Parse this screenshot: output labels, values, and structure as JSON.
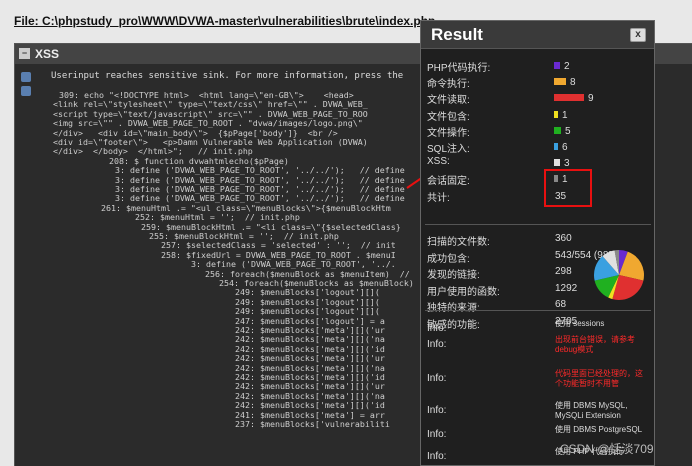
{
  "file_path": "File: C:\\phpstudy_pro\\WWW\\DVWA-master\\vulnerabilities\\brute\\index.php",
  "panel": {
    "title": "XSS",
    "message": "Userinput reaches sensitive sink. For more information, press the"
  },
  "code_lines": [
    "309: echo \"<!DOCTYPE html>  <html lang=\\\"en-GB\\\">    <head>",
    "<link rel=\\\"stylesheet\\\" type=\\\"text/css\\\" href=\\\"\" . DVWA_WEB_",
    "<script type=\\\"text/javascript\\\" src=\\\"\" . DVWA_WEB_PAGE_TO_ROO",
    "<img src=\\\"\" . DVWA_WEB_PAGE_TO_ROOT . \"dvwa/images/logo.png\\\"",
    "</div>   <div id=\\\"main_body\\\">  {$pPage['body']}  <br />",
    "<div id=\\\"footer\\\">   <p>Damn Vulnerable Web Application (DVWA)",
    "</div>  </body>  </html>\";   // init.php",
    "208: $ function dvwahtmlecho($pPage)",
    "3: define ('DVWA_WEB_PAGE_TO_ROOT', '../../');   // define",
    "3: define ('DVWA_WEB_PAGE_TO_ROOT', '../../');   // define",
    "3: define ('DVWA_WEB_PAGE_TO_ROOT', '../../');   // define",
    "3: define ('DVWA_WEB_PAGE_TO_ROOT', '../../');   // define",
    "261: $menuHtml .= \"<ul class=\\\"menuBlocks\\\">{$menuBlockHtm",
    "252: $menuHtml = '';  // init.php",
    "259: $menuBlockHtml .= \"<li class=\\\"{$selectedClass}",
    "255: $menuBlockHtml = '';  // init.php",
    "257: $selectedClass = 'selected' : '';  // init",
    "258: $fixedUrl = DVWA_WEB_PAGE_TO_ROOT . $menuI",
    "3: define ('DVWA_WEB_PAGE_TO_ROOT', '../.",
    "256: foreach($menuBlock as $menuItem)  //",
    "254: foreach($menuBlocks as $menuBlock)",
    "249: $menuBlocks['logout'][]( ",
    "249: $menuBlocks['logout'][]( ",
    "249: $menuBlocks['logout'][]( ",
    "247: $menuBlocks['logout'] = a",
    "242: $menuBlocks['meta'][]('ur",
    "242: $menuBlocks['meta'][]('na",
    "242: $menuBlocks['meta'][]('id",
    "242: $menuBlocks['meta'][]('ur",
    "242: $menuBlocks['meta'][]('na",
    "242: $menuBlocks['meta'][]('id",
    "242: $menuBlocks['meta'][]('ur",
    "242: $menuBlocks['meta'][]('na",
    "242: $menuBlocks['meta'][]('id",
    "241: $menuBlocks['meta'] = arr",
    "237: $menuBlocks['vulnerabiliti"
  ],
  "result": {
    "title": "Result",
    "close_label": "x",
    "vulns": [
      {
        "label": "PHP代码执行:",
        "value": "2",
        "color": "#6a2ad0"
      },
      {
        "label": "命令执行:",
        "value": "8",
        "color": "#f0a830"
      },
      {
        "label": "文件读取:",
        "value": "9",
        "color": "#e03030"
      },
      {
        "label": "文件包含:",
        "value": "1",
        "color": "#f0e020"
      },
      {
        "label": "文件操作:",
        "value": "5",
        "color": "#20b020"
      },
      {
        "label": "SQL注入:",
        "value": "6",
        "color": "#3aa0e0"
      },
      {
        "label": "XSS:",
        "value": "3",
        "color": "#e0e0e0"
      },
      {
        "label": "会话固定:",
        "value": "1",
        "color": "#888888"
      },
      {
        "label": "共计:",
        "value": "35",
        "color": ""
      }
    ],
    "stats": [
      {
        "label": "扫描的文件数:",
        "value": "360"
      },
      {
        "label": "成功包含:",
        "value": "543/554 (98%)"
      },
      {
        "label": "发现的链接:",
        "value": "298"
      },
      {
        "label": "用户使用的函数:",
        "value": "1292"
      },
      {
        "label": "独特的来源:",
        "value": "68"
      },
      {
        "label": "敏感的功能:",
        "value": "2705"
      }
    ],
    "info": [
      {
        "label": "Info:",
        "text": "使用 sessions",
        "red": false
      },
      {
        "label": "Info:",
        "text": "出现前台错误，请参考debug模式",
        "red": true
      },
      {
        "label": "Info:",
        "text": "代码里面已经处理的，这个功能暂时不用管",
        "red": true
      },
      {
        "label": "Info:",
        "text": "使用 DBMS MySQL, MySQLi Extension",
        "red": false
      },
      {
        "label": "Info:",
        "text": "使用 DBMS PostgreSQL",
        "red": false
      },
      {
        "label": "Info:",
        "text": "使用 PHP 代码执行",
        "red": false
      }
    ]
  },
  "watermark": "CSDN @恬淡709",
  "pie": [
    {
      "value": 2,
      "color": "#6a2ad0"
    },
    {
      "value": 8,
      "color": "#f0a830"
    },
    {
      "value": 9,
      "color": "#e03030"
    },
    {
      "value": 1,
      "color": "#f0e020"
    },
    {
      "value": 5,
      "color": "#20b020"
    },
    {
      "value": 6,
      "color": "#3aa0e0"
    },
    {
      "value": 3,
      "color": "#e0e0e0"
    },
    {
      "value": 1,
      "color": "#888888"
    }
  ]
}
